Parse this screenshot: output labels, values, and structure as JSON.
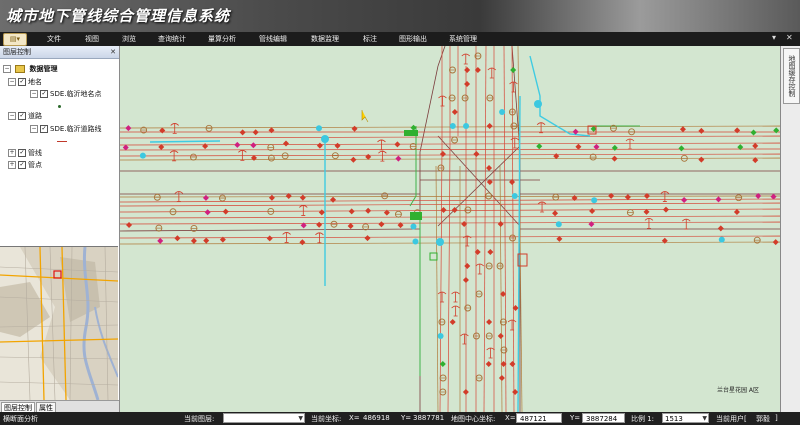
{
  "app": {
    "title": "城市地下管线综合管理信息系统"
  },
  "menu": {
    "file_button": "文件",
    "items": [
      "文件",
      "视图",
      "浏览",
      "查询统计",
      "量算分析",
      "管线编辑",
      "数据监理",
      "标注",
      "图形输出",
      "系统管理"
    ],
    "window_controls": [
      "▾",
      "✕"
    ]
  },
  "left_panel": {
    "header": "图层控制",
    "close": "✕",
    "tree": {
      "root": "数据管理",
      "diming": "地名",
      "diming_layer": "SDE.临沂地名点",
      "daolu": "道路",
      "daolu_layer": "SDE.临沂道路线",
      "guanxian": "管线",
      "guandian": "管点"
    },
    "tabs": [
      "图层控制",
      "属性"
    ]
  },
  "right_panel": {
    "tab": "地图缓存控制"
  },
  "map": {
    "annotation": "兰台星花园 A区"
  },
  "status": {
    "tool": "横断面分析",
    "current_layer_label": "当前图层:",
    "current_layer_value": "",
    "current_coord_label": "当前坐标:",
    "x_label": "X=",
    "x_value": "486918",
    "y_label": "Y=",
    "y_value": "3887781",
    "center_label": "地图中心坐标:",
    "center_x_label": "X=",
    "center_x_value": "487121",
    "center_y_label": "Y=",
    "center_y_value": "3887284",
    "scale_label": "比例 1:",
    "scale_value": "1513",
    "user_label": "当前用户[",
    "user_value": "郭毅",
    "user_close": "]"
  },
  "colors": {
    "map_bg": "#d3e6d0",
    "pipe_red": "#d23c2a",
    "pipe_brown": "#a8743a",
    "pipe_cyan": "#3cc8e0",
    "pipe_green": "#30b030",
    "pipe_magenta": "#d02080"
  }
}
